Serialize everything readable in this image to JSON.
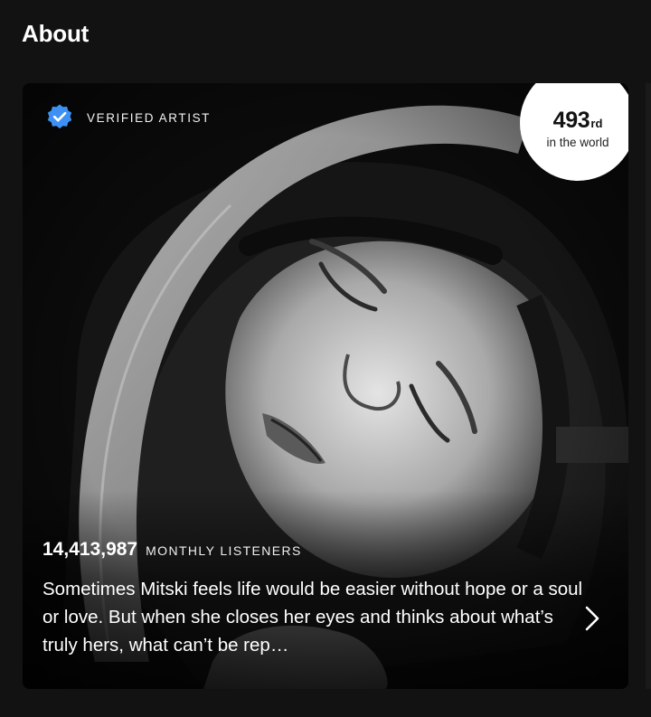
{
  "section": {
    "title": "About"
  },
  "artist_card": {
    "verified_label": "VERIFIED ARTIST",
    "rank": {
      "number": "493",
      "suffix": "rd",
      "subtitle": "in the world"
    },
    "monthly_listeners": {
      "count": "14,413,987",
      "label": "MONTHLY LISTENERS"
    },
    "bio": "Sometimes Mitski feels life would be easier without hope or a soul or love. But when she closes her eyes and thinks about what’s truly hers, what can’t be rep…"
  },
  "icons": {
    "verified": "verified-badge-icon",
    "chevron": "chevron-right-icon"
  },
  "colors": {
    "background": "#121212",
    "verified_badge": "#3d91f4",
    "rank_circle": "#ffffff"
  }
}
